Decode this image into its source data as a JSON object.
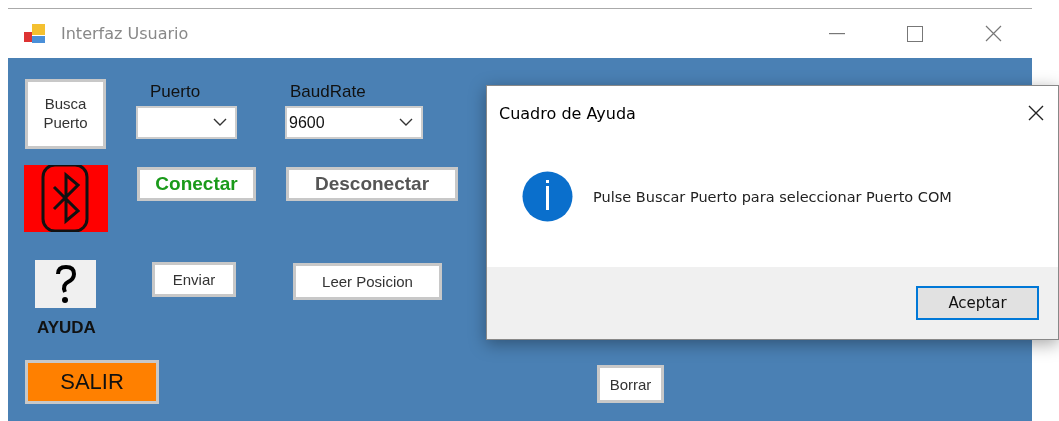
{
  "window": {
    "title": "Interfaz Usuario"
  },
  "form": {
    "search_port_button": "Busca\nPuerto",
    "port": {
      "label": "Puerto"
    },
    "baud_rate": {
      "label": "BaudRate",
      "value": "9600"
    },
    "connect_button": "Conectar",
    "disconnect_button": "Desconectar",
    "send_button": "Enviar",
    "read_button": "Leer Posicion",
    "help_label": "AYUDA",
    "exit_button": "SALIR",
    "clear_button": "Borrar"
  },
  "dialog": {
    "title": "Cuadro de Ayuda",
    "message": "Pulse Buscar Puerto para seleccionar Puerto COM",
    "buttons": [
      "Aceptar"
    ]
  }
}
